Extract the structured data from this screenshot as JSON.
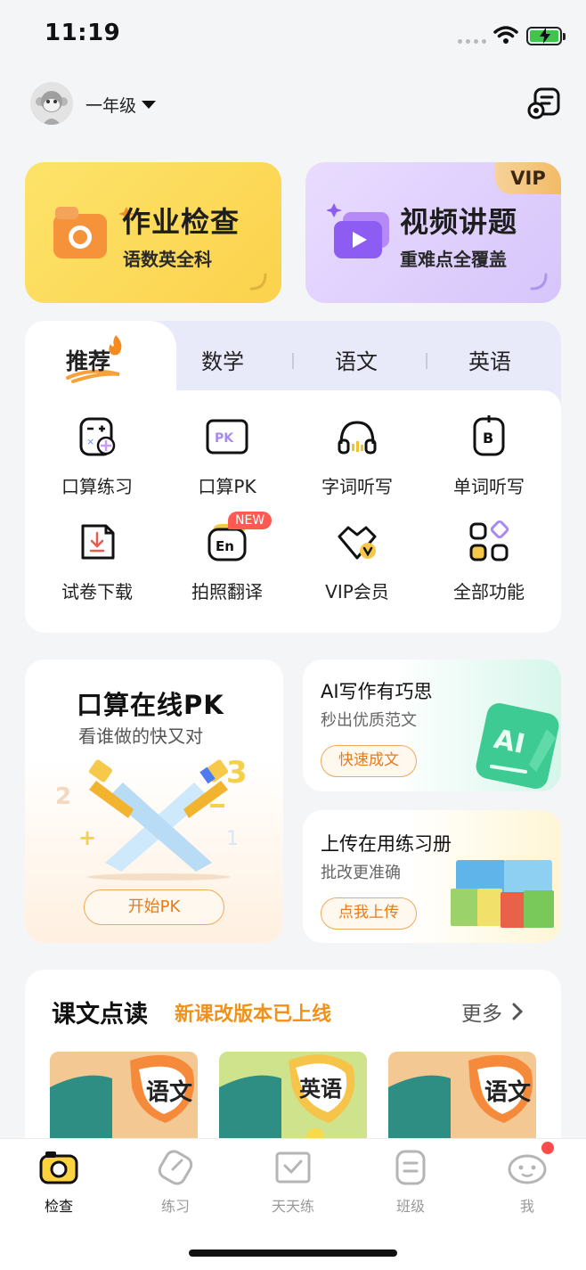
{
  "status": {
    "time": "11:19"
  },
  "header": {
    "grade": "一年级"
  },
  "cards": {
    "homework": {
      "title": "作业检查",
      "subtitle": "语数英全科"
    },
    "video": {
      "title": "视频讲题",
      "subtitle": "重难点全覆盖",
      "badge": "VIP"
    }
  },
  "tabs": [
    {
      "label": "推荐",
      "active": true
    },
    {
      "label": "数学",
      "active": false
    },
    {
      "label": "语文",
      "active": false
    },
    {
      "label": "英语",
      "active": false
    }
  ],
  "grid": [
    {
      "label": "口算练习",
      "icon": "calculator-icon"
    },
    {
      "label": "口算PK",
      "icon": "pk-icon"
    },
    {
      "label": "字词听写",
      "icon": "headphones-icon"
    },
    {
      "label": "单词听写",
      "icon": "word-dictation-icon"
    },
    {
      "label": "试卷下载",
      "icon": "download-paper-icon"
    },
    {
      "label": "拍照翻译",
      "icon": "translate-icon",
      "badge": "NEW"
    },
    {
      "label": "VIP会员",
      "icon": "vip-crown-icon"
    },
    {
      "label": "全部功能",
      "icon": "all-features-icon"
    }
  ],
  "pk_card": {
    "title": "口算在线PK",
    "subtitle": "看谁做的快又对",
    "button": "开始PK"
  },
  "ai_card": {
    "title": "AI写作有巧思",
    "subtitle": "秒出优质范文",
    "button": "快速成文",
    "art_text": "AI"
  },
  "upload_card": {
    "title": "上传在用练习册",
    "subtitle": "批改更准确",
    "button": "点我上传"
  },
  "reading": {
    "title": "课文点读",
    "subtitle": "新课改版本已上线",
    "more": "更多",
    "books": [
      {
        "cover_text": "语文"
      },
      {
        "cover_text": "英语"
      },
      {
        "cover_text": "语文"
      }
    ]
  },
  "bottom_nav": [
    {
      "label": "检查",
      "active": true
    },
    {
      "label": "练习",
      "active": false
    },
    {
      "label": "天天练",
      "active": false
    },
    {
      "label": "班级",
      "active": false
    },
    {
      "label": "我",
      "active": false
    }
  ],
  "colors": {
    "accent_orange": "#f09219",
    "badge_red": "#ff5a52",
    "homework_yellow": "#fbd24c",
    "video_purple": "#d6c5fb"
  }
}
